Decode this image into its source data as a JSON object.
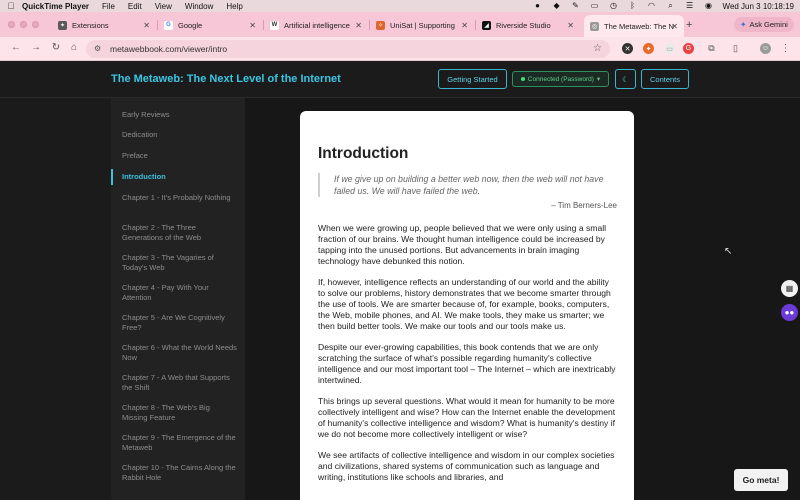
{
  "menubar": {
    "apple": "",
    "items": [
      "QuickTime Player",
      "File",
      "Edit",
      "View",
      "Window",
      "Help"
    ],
    "clock": "Wed Jun 3  10:18:19"
  },
  "tabs": [
    {
      "title": "Extensions",
      "icon": "extensions-icon",
      "color": "#5a5a5a"
    },
    {
      "title": "Google",
      "icon": "google-icon",
      "color": "#4285f4"
    },
    {
      "title": "Artificial intelligence",
      "icon": "wikipedia-icon",
      "color": "#444444"
    },
    {
      "title": "UniSat | Supporting",
      "icon": "unisat-icon",
      "color": "#e0662c"
    },
    {
      "title": "Riverside Studio",
      "icon": "riverside-icon",
      "color": "#111111"
    },
    {
      "title": "The Metaweb: The N",
      "icon": "globe-icon",
      "color": "#777777"
    }
  ],
  "gemini": {
    "label": "Ask Gemini"
  },
  "address": {
    "url": "metawebbook.com/viewer/intro"
  },
  "header": {
    "title": "The Metaweb: The Next Level of the Internet",
    "getting_started": "Getting Started",
    "status": "Connected (Password)",
    "theme_icon": "moon-icon",
    "contents": "Contents"
  },
  "toc": [
    "Early Reviews",
    "Dedication",
    "Preface",
    "Introduction",
    "Chapter 1 - It's Probably Nothing",
    "Chapter 2 - The Three Generations of the Web",
    "Chapter 3 - The Vagaries of Today's Web",
    "Chapter 4 - Pay With Your Attention",
    "Chapter 5 - Are We Cognitively Free?",
    "Chapter 6 - What the World Needs Now",
    "Chapter 7 - A Web that Supports the Shift",
    "Chapter 8 - The Web's Big Missing Feature",
    "Chapter 9 - The Emergence of the Metaweb",
    "Chapter 10 - The Cairns Along the Rabbit Hole"
  ],
  "toc_active": "Introduction",
  "content": {
    "heading": "Introduction",
    "quote": "If we give up on building a better web now, then the web will not have failed us. We will have failed the web.",
    "attribution": "– Tim Berners-Lee",
    "paragraphs": [
      "When we were growing up, people believed that we were only using a small fraction of our brains. We thought human intelligence could be increased by tapping into the unused portions. But advancements in brain imaging technology have debunked this notion.",
      "If, however, intelligence reflects an understanding of our world and the ability to solve our problems, history demonstrates that we become smarter through the use of tools. We are smarter because of, for example, books, computers, the Web, mobile phones, and AI. We make tools, they make us smarter; we then build better tools. We make our tools and our tools make us.",
      "Despite our ever-growing capabilities, this book contends that we are only scratching the surface of what's possible regarding humanity's collective intelligence and our most important tool – The Internet – which are inextricably intertwined.",
      "This brings up several questions. What would it mean for humanity to be more collectively intelligent and wise? How can the Internet enable the development of humanity's collective intelligence and wisdom? What is humanity's destiny if we do not become more collectively intelligent or wise?",
      "We see artifacts of collective intelligence and wisdom in our complex societies and civilizations, shared systems of communication such as language and writing, institutions like schools and libraries, and"
    ]
  },
  "go_meta": "Go meta!"
}
